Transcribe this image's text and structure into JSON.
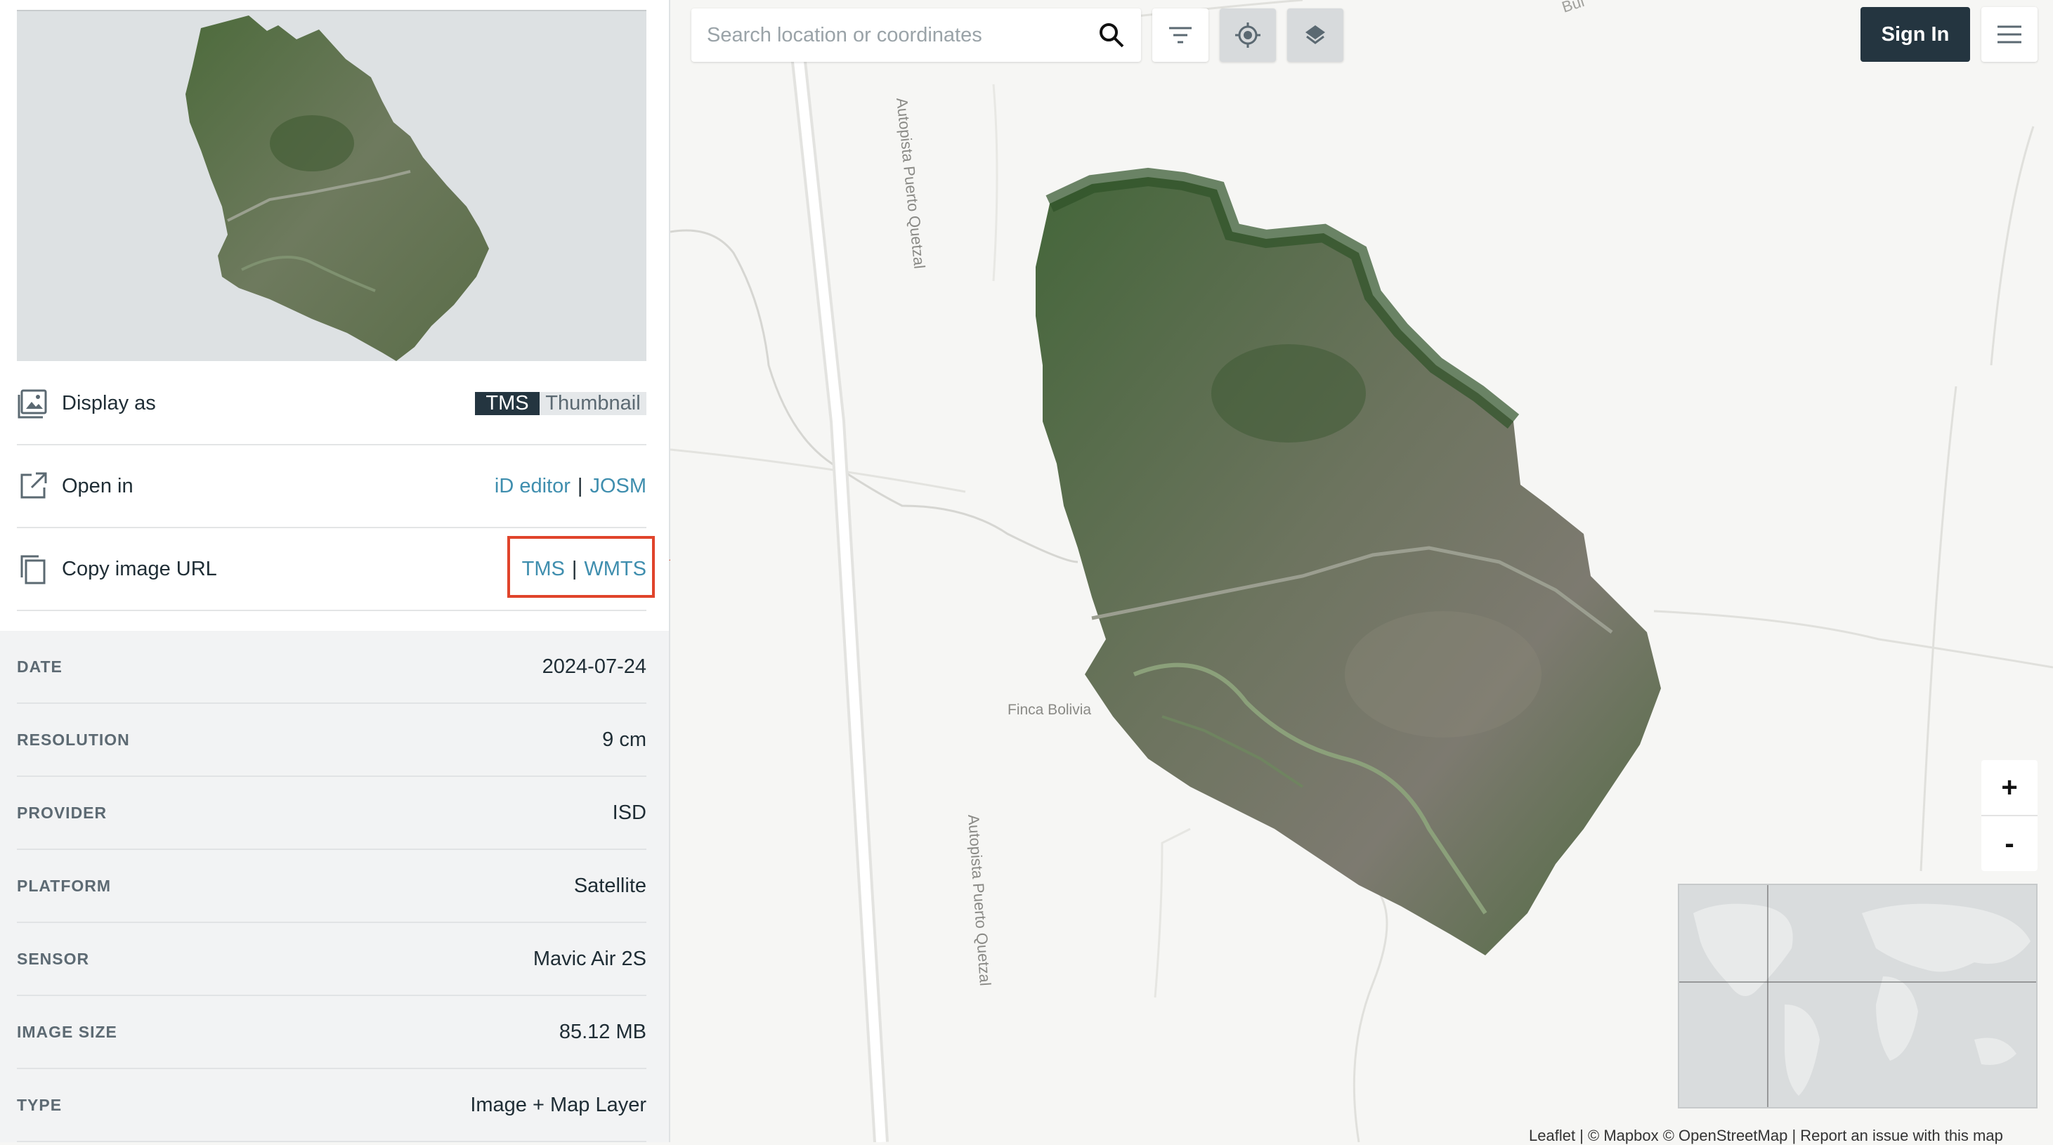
{
  "sidebar": {
    "display_as": {
      "label": "Display as",
      "options": [
        "TMS",
        "Thumbnail"
      ],
      "selected": "TMS"
    },
    "open_in": {
      "label": "Open in",
      "links": [
        "iD editor",
        "JOSM"
      ],
      "separator": "|"
    },
    "copy_url": {
      "label": "Copy image URL",
      "links": [
        "TMS",
        "WMTS"
      ],
      "separator": "|"
    },
    "metadata": [
      {
        "key": "DATE",
        "value": "2024-07-24"
      },
      {
        "key": "RESOLUTION",
        "value": "9 cm"
      },
      {
        "key": "PROVIDER",
        "value": "ISD"
      },
      {
        "key": "PLATFORM",
        "value": "Satellite"
      },
      {
        "key": "SENSOR",
        "value": "Mavic Air 2S"
      },
      {
        "key": "IMAGE SIZE",
        "value": "85.12 MB"
      },
      {
        "key": "TYPE",
        "value": "Image + Map Layer"
      }
    ]
  },
  "map": {
    "search_placeholder": "Search location or coordinates",
    "signin_label": "Sign In",
    "zoom_in": "+",
    "zoom_out": "-",
    "labels": {
      "road_1": "Autopista Puerto Quetzal",
      "road_2": "Autopista Puerto Quetzal",
      "place": "Finca Bolivia",
      "top_road": "Bul"
    },
    "attribution": "Leaflet | © Mapbox © OpenStreetMap | Report an issue with this map"
  },
  "colors": {
    "accent_dark": "#243540",
    "link": "#3f8eae",
    "highlight": "#e0442b"
  },
  "icons": [
    "image-icon",
    "open-external-icon",
    "copy-icon",
    "search-icon",
    "filter-icon",
    "locate-icon",
    "layers-icon",
    "menu-icon"
  ]
}
